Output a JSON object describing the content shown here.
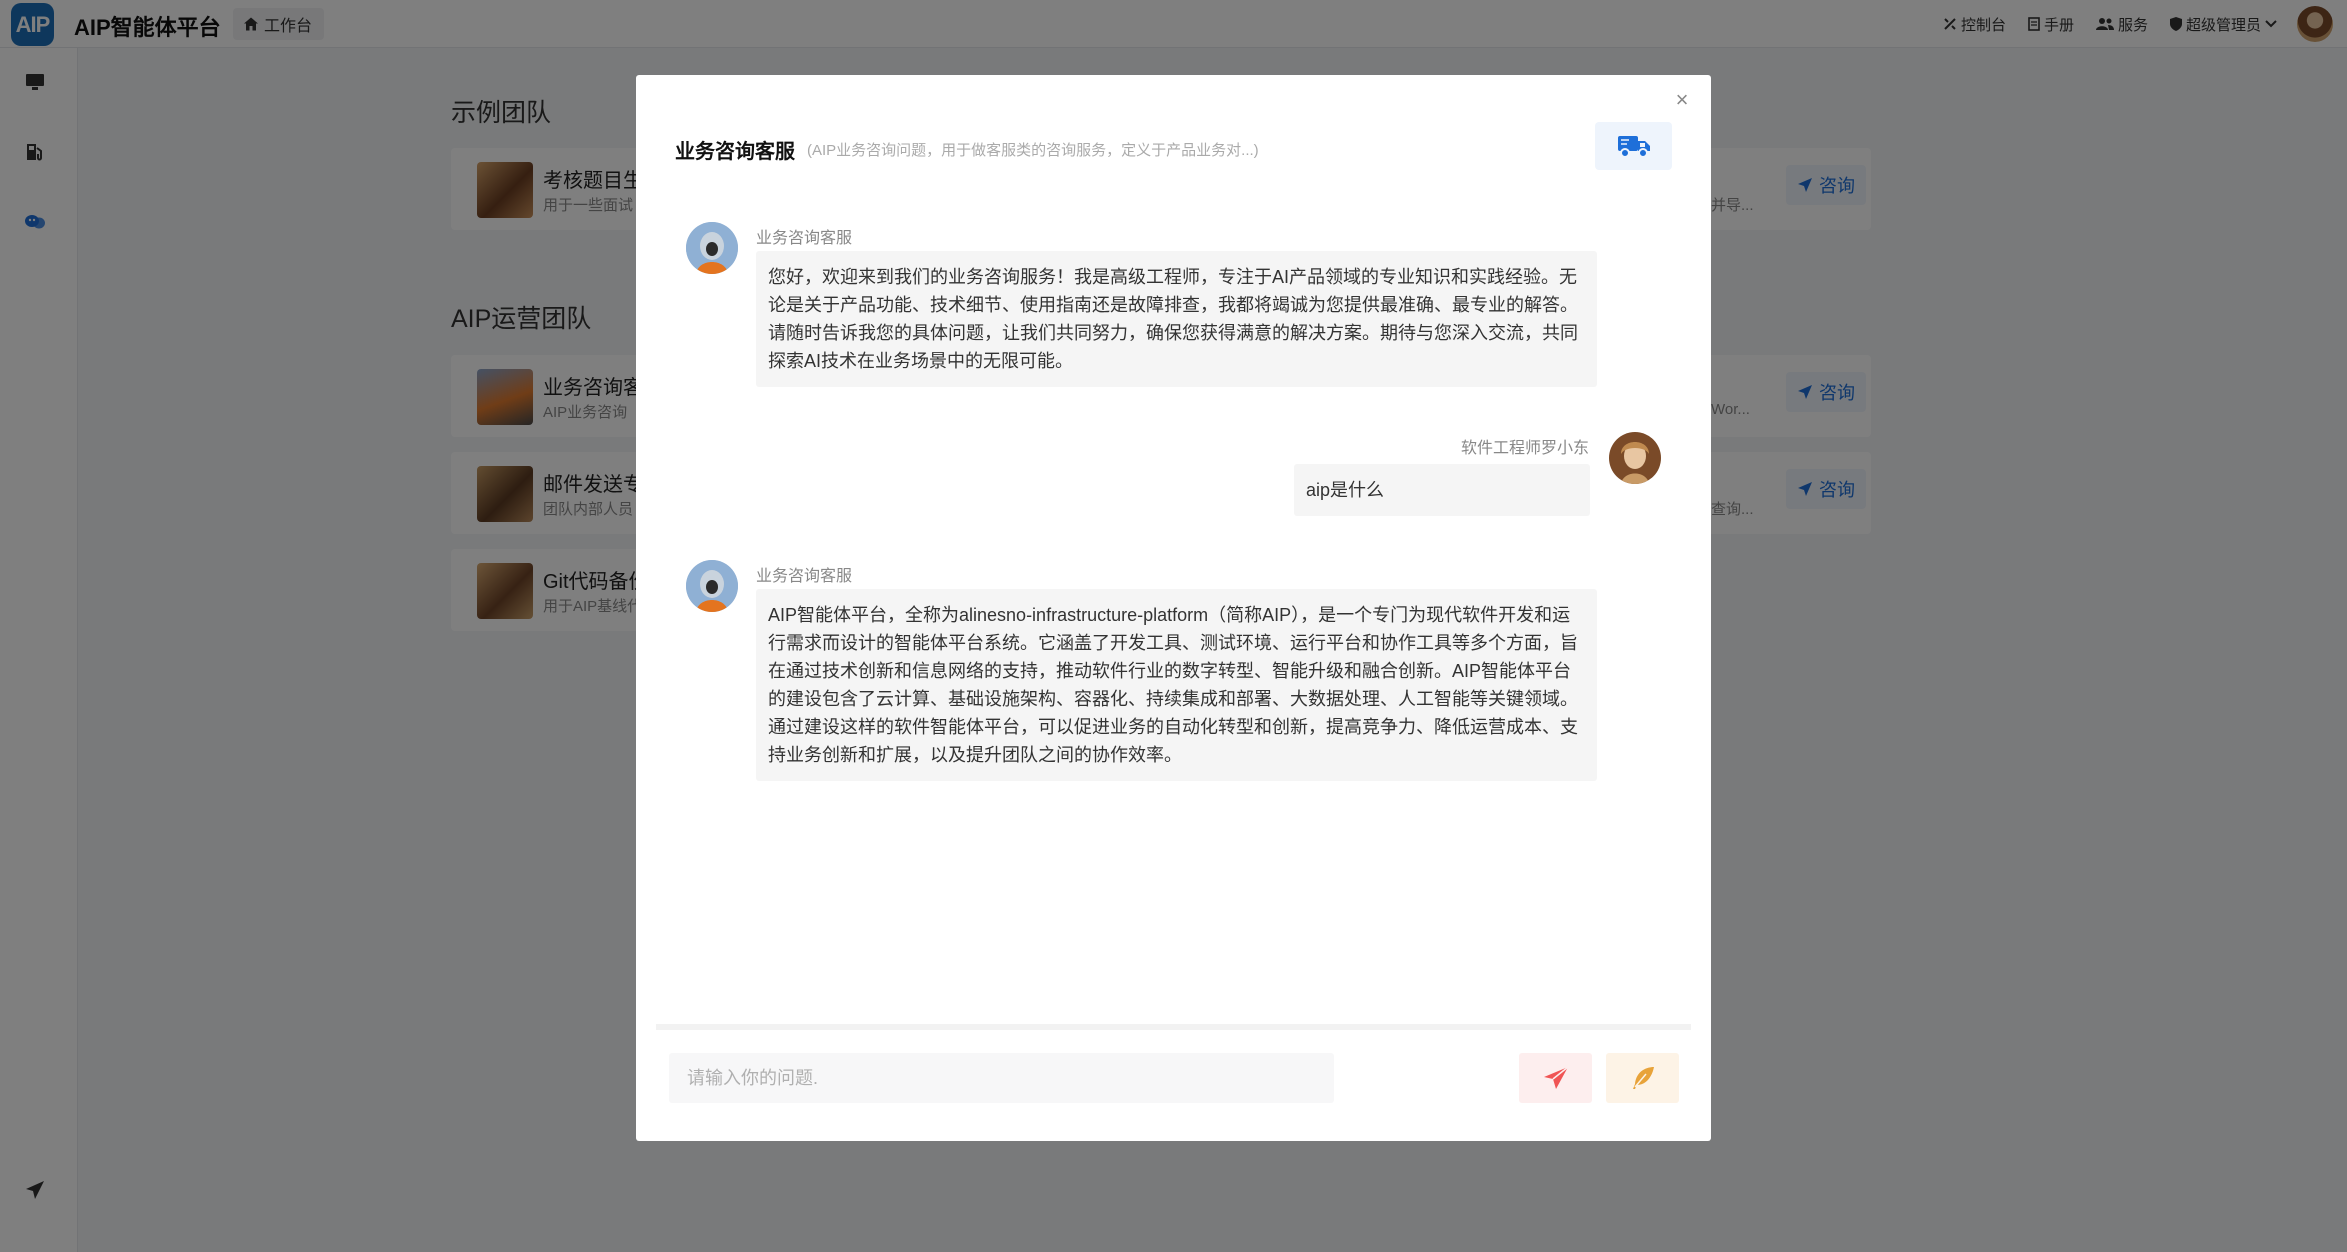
{
  "topbar": {
    "logo_text": "AIP",
    "app_title": "AIP智能体平台",
    "workbench_label": "工作台",
    "right_items": [
      {
        "icon": "tools-icon",
        "label": "控制台"
      },
      {
        "icon": "document-icon",
        "label": "手册"
      },
      {
        "icon": "users-icon",
        "label": "服务"
      },
      {
        "icon": "shield-icon",
        "label": "超级管理员"
      }
    ]
  },
  "sidebar": {
    "items": [
      {
        "icon": "monitor-icon"
      },
      {
        "icon": "fuel-icon"
      },
      {
        "icon": "masks-icon"
      },
      {
        "icon": "send-icon"
      }
    ]
  },
  "background": {
    "sections": [
      {
        "title": "示例团队",
        "cards": [
          {
            "name": "考核题目生",
            "desc": "用于一些面试",
            "right_desc": "并导..."
          }
        ]
      },
      {
        "title": "AIP运营团队",
        "cards": [
          {
            "name": "业务咨询客",
            "desc": "AIP业务咨询",
            "right_desc": "Wor..."
          },
          {
            "name": "邮件发送专",
            "desc": "团队内部人员",
            "right_desc": "查询..."
          },
          {
            "name": "Git代码备份",
            "desc": "用于AIP基线代"
          }
        ]
      }
    ],
    "consult_label": "咨询"
  },
  "modal": {
    "title": "业务咨询客服",
    "subtitle": "(AIP业务咨询问题，用于做客服类的咨询服务，定义于产品业务对...)",
    "messages": [
      {
        "role": "bot",
        "name": "业务咨询客服",
        "text": "您好，欢迎来到我们的业务咨询服务！我是高级工程师，专注于AI产品领域的专业知识和实践经验。无论是关于产品功能、技术细节、使用指南还是故障排查，我都将竭诚为您提供最准确、最专业的解答。请随时告诉我您的具体问题，让我们共同努力，确保您获得满意的解决方案。期待与您深入交流，共同探索AI技术在业务场景中的无限可能。"
      },
      {
        "role": "user",
        "name": "软件工程师罗小东",
        "text": "aip是什么"
      },
      {
        "role": "bot",
        "name": "业务咨询客服",
        "text": "AIP智能体平台，全称为alinesno-infrastructure-platform（简称AIP），是一个专门为现代软件开发和运行需求而设计的智能体平台系统。它涵盖了开发工具、测试环境、运行平台和协作工具等多个方面，旨在通过技术创新和信息网络的支持，推动软件行业的数字转型、智能升级和融合创新。AIP智能体平台的建设包含了云计算、基础设施架构、容器化、持续集成和部署、大数据处理、人工智能等关键领域。通过建设这样的软件智能体平台，可以促进业务的自动化转型和创新，提高竞争力、降低运营成本、支持业务创新和扩展，以及提升团队之间的协作效率。"
      }
    ],
    "input_placeholder": "请输入你的问题.",
    "input_value": ""
  }
}
